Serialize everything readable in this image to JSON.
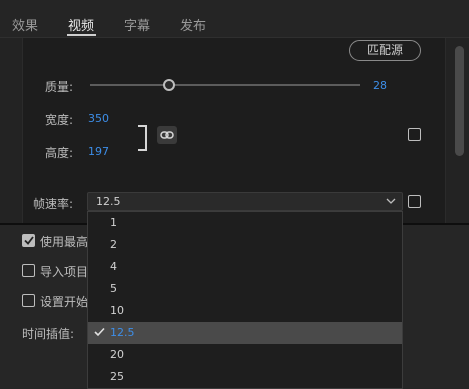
{
  "tabs": [
    {
      "label": "效果",
      "active": false
    },
    {
      "label": "视频",
      "active": true
    },
    {
      "label": "字幕",
      "active": false
    },
    {
      "label": "发布",
      "active": false
    }
  ],
  "video": {
    "match_source_label": "匹配源",
    "quality_label": "质量:",
    "quality_value": "28",
    "quality_fraction": 0.28,
    "width_label": "宽度:",
    "width_value": "350",
    "height_label": "高度:",
    "height_value": "197",
    "link_icon": "link-icon",
    "frame_rate_label": "帧速率:",
    "frame_rate_value": "12.5",
    "frame_rate_options": [
      "1",
      "2",
      "4",
      "5",
      "10",
      "12.5",
      "20",
      "25"
    ],
    "frame_rate_selected": "12.5"
  },
  "lower": {
    "use_max_label": "使用最高",
    "use_max_checked": true,
    "import_project_label": "导入项目",
    "import_project_checked": false,
    "set_start_label": "设置开始",
    "set_start_checked": false,
    "time_interp_label": "时间插值:"
  },
  "colors": {
    "accent_blue": "#3d8ee8",
    "background": "#232323"
  }
}
